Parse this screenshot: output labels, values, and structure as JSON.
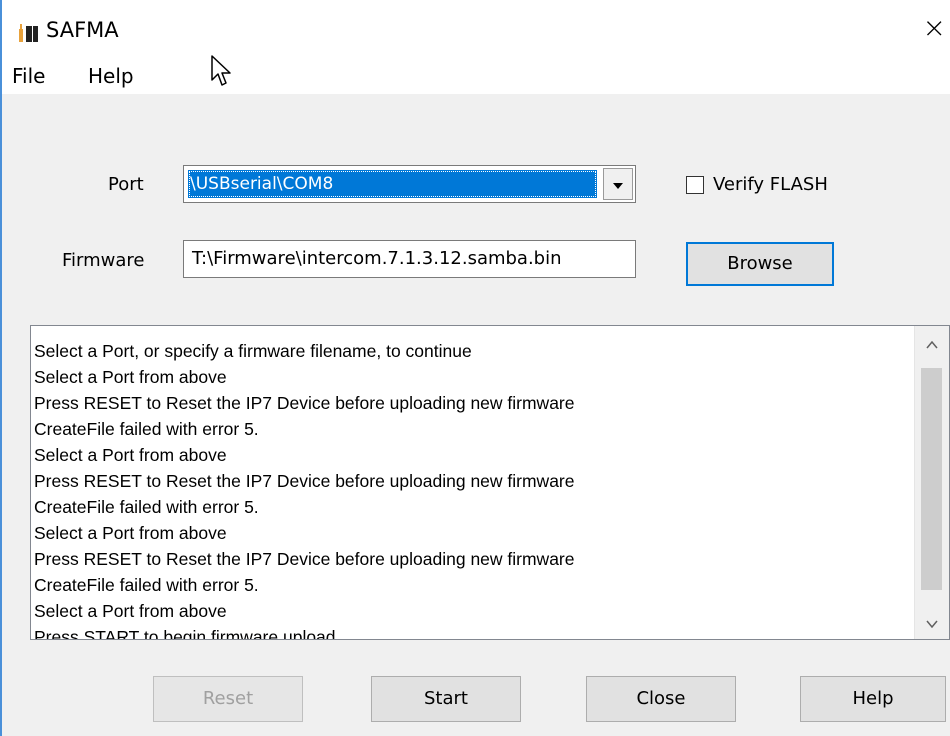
{
  "window": {
    "title": "SAFMA",
    "close_glyph": "×"
  },
  "menu": {
    "items": [
      {
        "label": "File"
      },
      {
        "label": "Help"
      }
    ]
  },
  "form": {
    "port_label": "Port",
    "port_selected": "\\USBserial\\COM8",
    "verify_label": "Verify FLASH",
    "verify_checked": false,
    "firmware_label": "Firmware",
    "firmware_value": "T:\\Firmware\\intercom.7.1.3.12.samba.bin",
    "browse_label": "Browse"
  },
  "log": {
    "lines": [
      "Select a Port, or specify a firmware filename, to continue",
      "Select a Port from above",
      "Press RESET to Reset the IP7 Device before uploading new firmware",
      "CreateFile failed with error 5.",
      "Select a Port from above",
      "Press RESET to Reset the IP7 Device before uploading new firmware",
      "CreateFile failed with error 5.",
      "Select a Port from above",
      "Press RESET to Reset the IP7 Device before uploading new firmware",
      "CreateFile failed with error 5.",
      "Select a Port from above",
      "Press START to begin firmware upload"
    ]
  },
  "buttons": {
    "reset": "Reset",
    "start": "Start",
    "close": "Close",
    "help": "Help"
  },
  "icons": {
    "app": "app-icon",
    "dropdown": "chevron-down-icon",
    "scroll_up": "chevron-up-icon",
    "scroll_down": "chevron-down-icon",
    "cursor": "mouse-pointer-icon"
  },
  "colors": {
    "accent": "#0078d7",
    "window_border": "#4a90d9"
  }
}
